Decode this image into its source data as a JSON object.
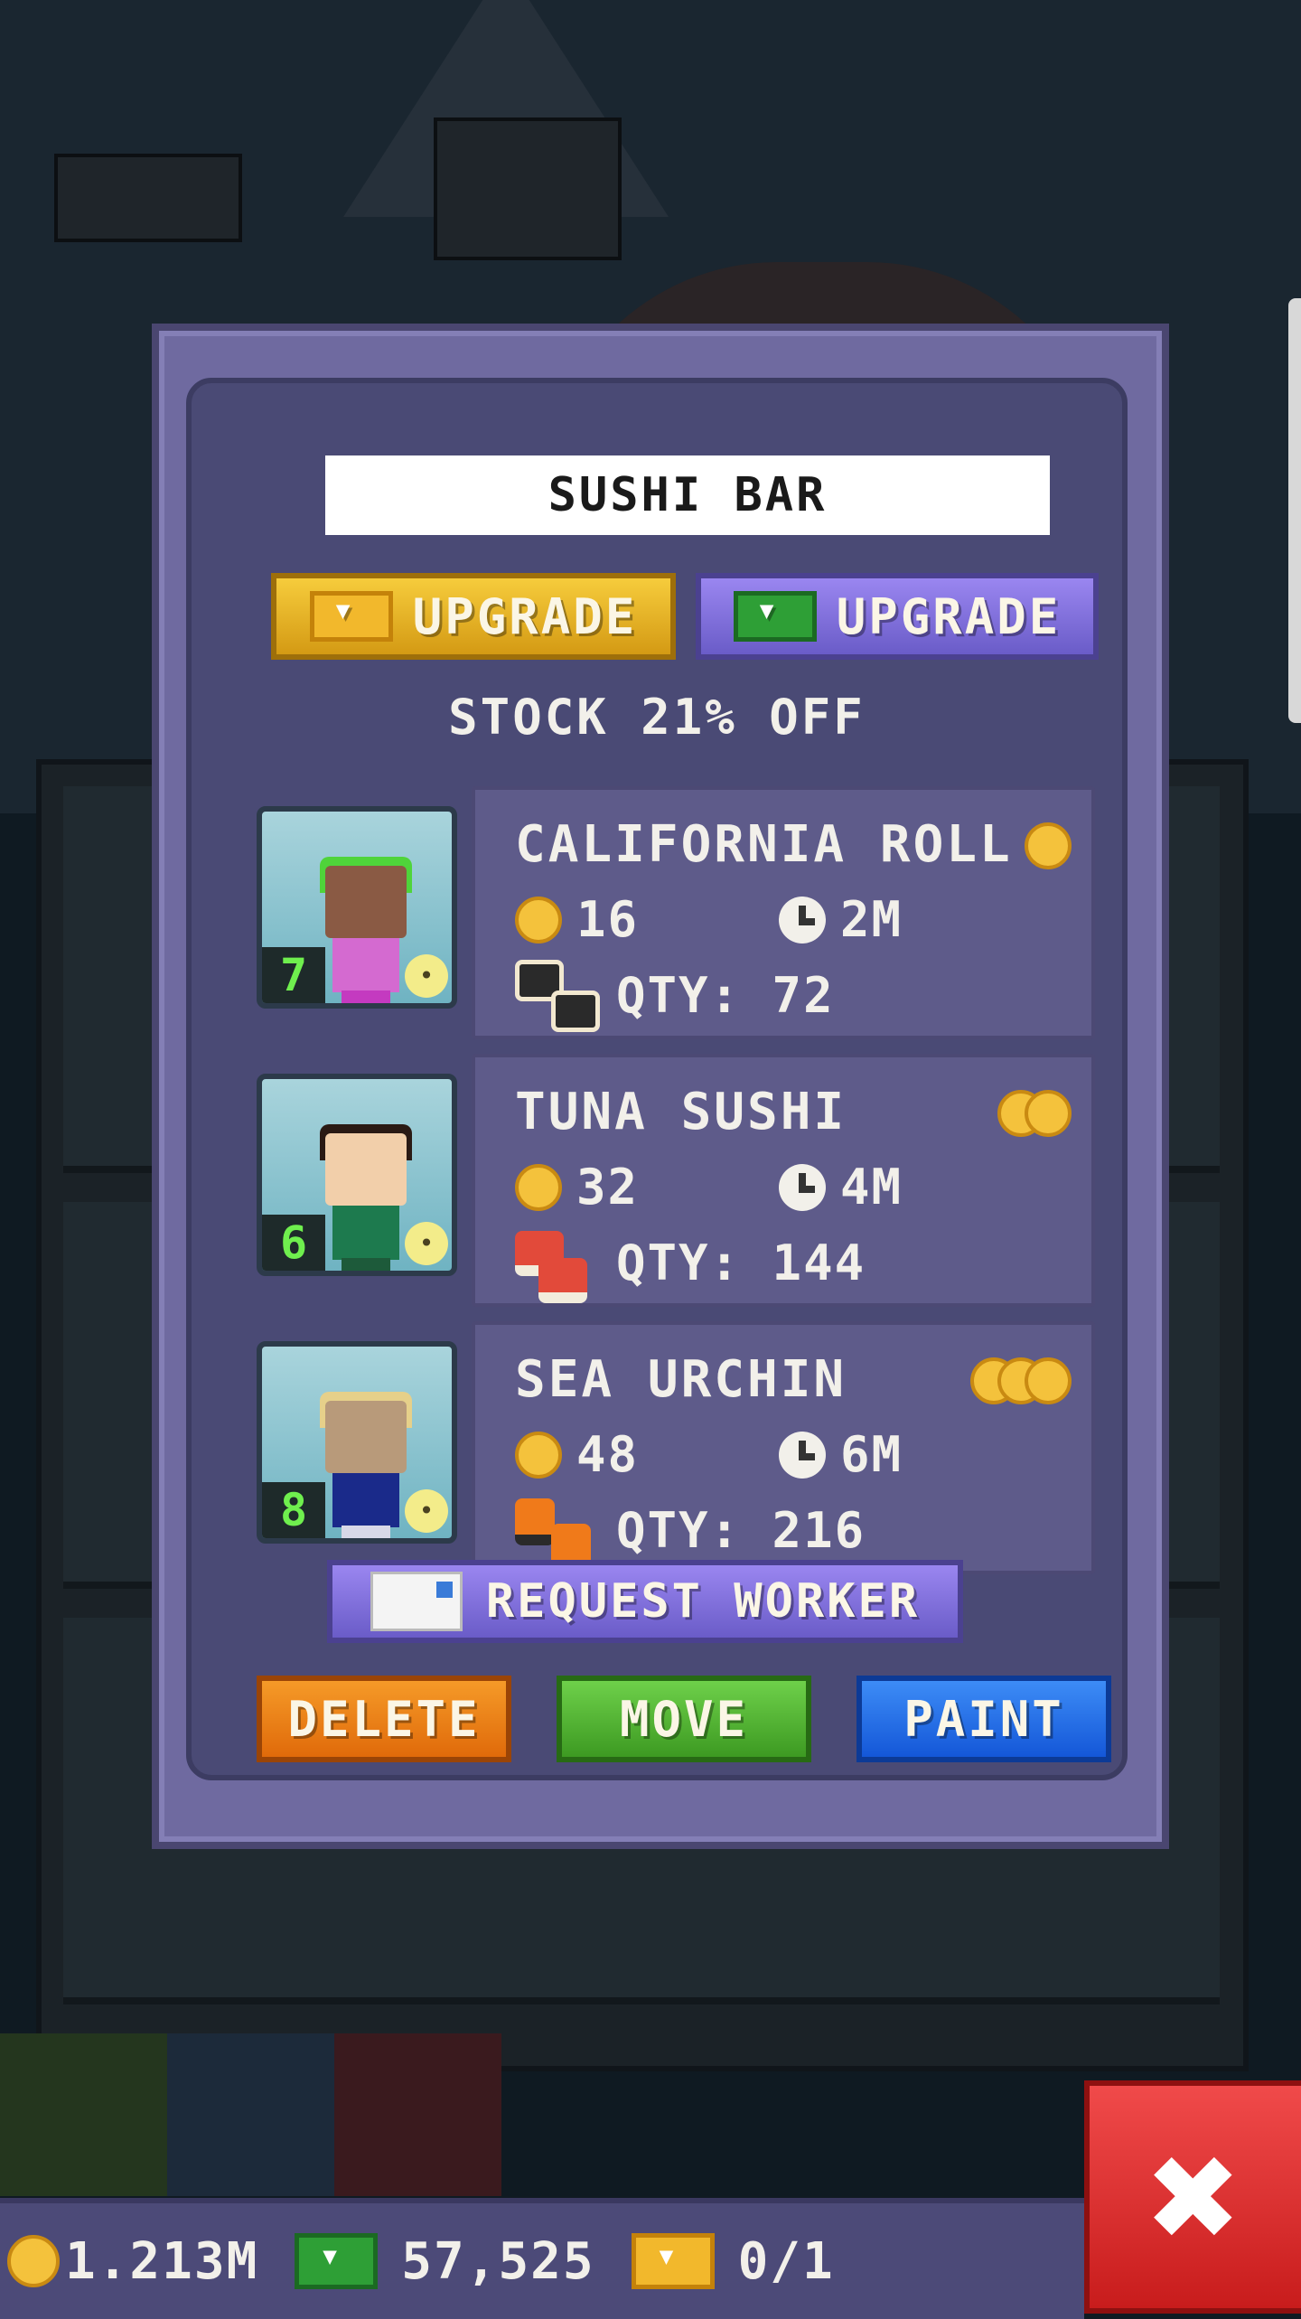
{
  "modal": {
    "title": "SUSHI BAR",
    "upgrade_gold_label": "UPGRADE",
    "upgrade_bux_label": "UPGRADE",
    "stock_text": "STOCK 21% OFF",
    "products": [
      {
        "name": "CALIFORNIA ROLL",
        "tier_coins": 1,
        "cost": "16",
        "time": "2M",
        "qty": "QTY: 72",
        "worker_level": "7",
        "worker_hair": "#4fd43a",
        "worker_skin": "#8a5a44",
        "worker_shirt": "#d46ad0",
        "icon": "california-roll-icon"
      },
      {
        "name": "TUNA SUSHI",
        "tier_coins": 2,
        "cost": "32",
        "time": "4M",
        "qty": "QTY: 144",
        "worker_level": "6",
        "worker_hair": "#2a1a14",
        "worker_skin": "#f2cfaa",
        "worker_shirt": "#1d7a4e",
        "icon": "tuna-sushi-icon"
      },
      {
        "name": "SEA URCHIN",
        "tier_coins": 3,
        "cost": "48",
        "time": "6M",
        "qty": "QTY: 216",
        "worker_level": "8",
        "worker_hair": "#e6d08a",
        "worker_skin": "#b89a7a",
        "worker_shirt": "#1a2a8a",
        "icon": "sea-urchin-icon"
      }
    ],
    "request_worker_label": "REQUEST WORKER",
    "delete_label": "DELETE",
    "move_label": "MOVE",
    "paint_label": "PAINT"
  },
  "status_bar": {
    "coins": "1.213M",
    "bux": "57,525",
    "tickets": "0/1"
  },
  "colors": {
    "modal_bg": "#6f6aa0",
    "gold": "#f2b82c",
    "purple": "#7a6ae0",
    "delete": "#f08a1c",
    "move": "#54b432",
    "paint": "#2a72ee",
    "close": "#e03030"
  }
}
